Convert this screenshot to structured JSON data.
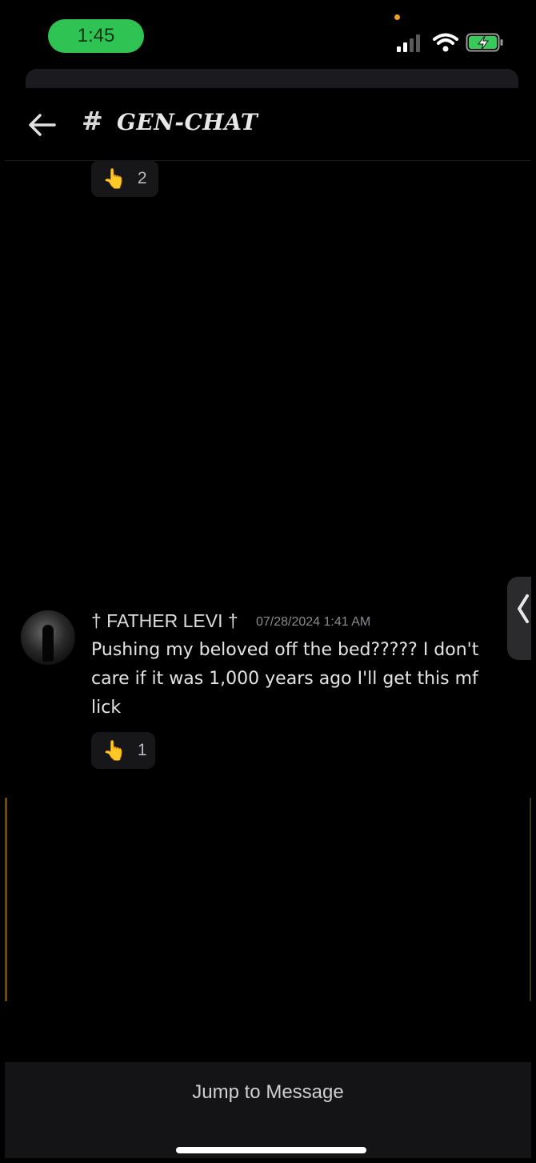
{
  "status_bar": {
    "time": "1:45",
    "signal_icon": "cellular-signal-icon",
    "wifi_icon": "wifi-icon",
    "battery_icon": "battery-charging-icon"
  },
  "header": {
    "back_icon": "back-arrow-icon",
    "hash_symbol": "#",
    "channel_name": "GEN-CHAT"
  },
  "reactions_top": {
    "emoji": "👆",
    "count": "2"
  },
  "message": {
    "username": "† FATHER LEVI †",
    "timestamp": "07/28/2024 1:41 AM",
    "text": "Pushing my beloved off the bed????? I don't care if it was 1,000 years ago I'll get this mf lick",
    "reaction": {
      "emoji": "👆",
      "count": "1"
    }
  },
  "bottom": {
    "jump_label": "Jump to Message"
  },
  "colors": {
    "background": "#000000",
    "time_pill": "#2ec353",
    "reaction_bg": "#17171a",
    "bottom_bar": "#141416"
  }
}
